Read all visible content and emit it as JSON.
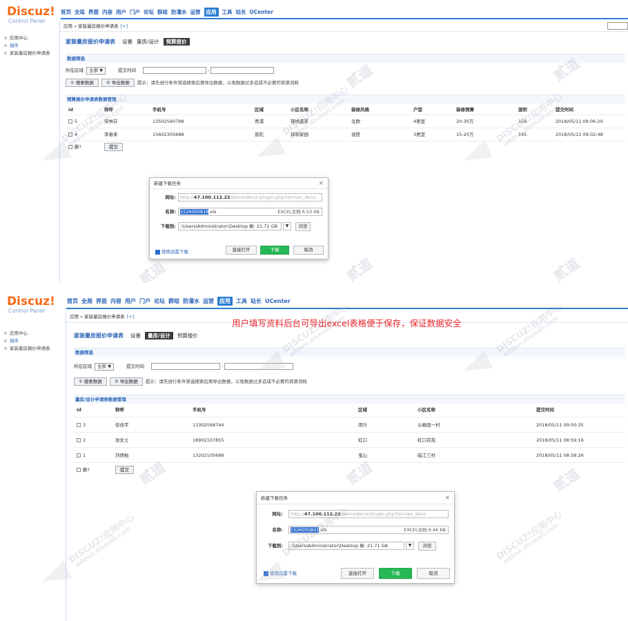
{
  "brand": {
    "name": "Discuz!",
    "sub": "Control Panel"
  },
  "nav": [
    "首页",
    "全局",
    "界面",
    "内容",
    "用户",
    "门户",
    "论坛",
    "群组",
    "防灌水",
    "运营",
    "应用",
    "工具",
    "站长",
    "UCenter"
  ],
  "nav_active_index": 10,
  "sidebar": [
    "应用中心",
    "插件",
    "家装量房报价申请表"
  ],
  "sidebar_current_index": 1,
  "crumb": {
    "path": "应用 » 家装量房报价申请表",
    "plus": "[+]"
  },
  "title": {
    "main": "家装量房报价申请表",
    "tab_settings": "设置",
    "tab_measure": "量房/设计",
    "tab_quote": "预算报价"
  },
  "filter": {
    "section": "数据筛选",
    "area_label": "所在区域",
    "area_value": "全部 ▼",
    "time_label": "提交时间",
    "dash": "-"
  },
  "buttons": {
    "search": "① 搜索数据",
    "export": "② 导出数据",
    "hint": "提示：请先进行条件筛选搜索后再导出数据，以免数据过多造成不必要的资源消耗",
    "delete": "删?",
    "submit": "提交"
  },
  "table_a": {
    "section": "预算报价申请表数据管理",
    "headers": [
      "id",
      "称呼",
      "手机号",
      "区域",
      "小区名称",
      "装修风格",
      "户型",
      "装修预算",
      "面积",
      "提交时间"
    ],
    "rows": [
      [
        "5",
        "宋林芬",
        "13502560788",
        "青浦",
        "锦绣盛景",
        "北欧",
        "4居室",
        "20-30万",
        "156",
        "2018/05/11 09:06:20"
      ],
      [
        "4",
        "李春来",
        "15602305688",
        "普陀",
        "祥和家园",
        "混搭",
        "3居室",
        "15-20万",
        "145",
        "2018/05/11 09:02:48"
      ]
    ]
  },
  "table_b": {
    "section": "量房/设计申请表数据管理",
    "headers": [
      "id",
      "称呼",
      "手机号",
      "区域",
      "小区名称",
      "提交时间"
    ],
    "rows": [
      [
        "3",
        "徐佳宇",
        "13302568744",
        "闵行",
        "沁春园一村",
        "2018/05/11 09:00:35"
      ],
      [
        "2",
        "张女士",
        "18902107855",
        "虹口",
        "虹口花苑",
        "2018/05/11 08:59:16"
      ],
      [
        "1",
        "刘德柏",
        "13202105688",
        "宝山",
        "临江三村",
        "2018/05/11 08:58:26"
      ]
    ]
  },
  "dialog_a": {
    "title": "新建下载任务",
    "close": "×",
    "url_label": "网址:",
    "url_prefix": "http://",
    "url_host": "47.100.112.22",
    "url_rest": "/demo/decor/plugin.php?id=nex_deco",
    "name_label": "名称:",
    "name_sel": "1526000818",
    "name_ext": ".xls",
    "file_type": "EXCEL文档 6.53 KB",
    "path_label": "下载到:",
    "path": ":\\Users\\Administrator\\Desktop  剩: 21.71 GB",
    "dropdown": "▼",
    "browse": "浏览",
    "link": "使用迅雷下载",
    "open": "直接打开",
    "download": "下载",
    "cancel": "取消"
  },
  "dialog_b": {
    "title": "新建下载任务",
    "close": "×",
    "url_label": "网址:",
    "url_prefix": "http://",
    "url_host": "47.100.112.22",
    "url_rest": "/demo/decor/plugin.php?id=nex_deco",
    "name_label": "名称:",
    "name_sel": "1526000841",
    "name_ext": ".xls",
    "file_type": "EXCEL文档 6.46 KB",
    "path_label": "下载到:",
    "path": ":\\Users\\Administrator\\Desktop  剩: 21.71 GB",
    "dropdown": "▼",
    "browse": "浏览",
    "link": "使用迅雷下载",
    "open": "直接打开",
    "download": "下载",
    "cancel": "取消"
  },
  "annotation": "用户填写资料后台可导出excel表格便于保存，保证数据安全",
  "watermark": {
    "brand": "DISCUZ!应用中心",
    "domain": "addon.dismall.com",
    "mark": "贰道"
  },
  "colors": {
    "accent": "#2b7dd1",
    "logo": "#f66b17",
    "download_button": "#27b856",
    "annotation": "#e8262a"
  }
}
